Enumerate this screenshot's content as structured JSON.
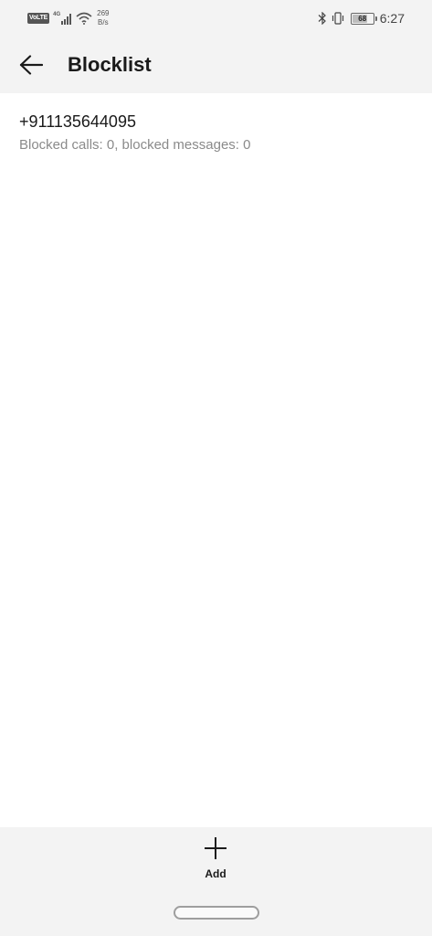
{
  "status_bar": {
    "volte": "VoLTE",
    "network": "4G",
    "speed_value": "269",
    "speed_unit": "B/s",
    "battery_level": "68",
    "battery_percent": 68,
    "time": "6:27",
    "icons": [
      "volte-icon",
      "signal-icon",
      "wifi-icon",
      "bluetooth-icon",
      "vibrate-icon",
      "battery-icon"
    ]
  },
  "app_bar": {
    "back_icon": "back-arrow-icon",
    "title": "Blocklist"
  },
  "blocklist": {
    "items": [
      {
        "number": "+911135644095",
        "detail": "Blocked calls: 0, blocked messages: 0"
      }
    ]
  },
  "bottom_bar": {
    "add_icon": "plus-icon",
    "add_label": "Add"
  }
}
